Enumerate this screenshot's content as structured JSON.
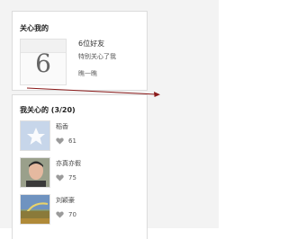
{
  "care_panel": {
    "title": "关心我的",
    "number": "6",
    "count_text": "6位好友",
    "desc_text": "特别关心了我",
    "link_text": "瞧一瞧"
  },
  "following_panel": {
    "title": "我关心的 (3/20)",
    "people": [
      {
        "name": "稻香",
        "count": "61",
        "avatar": "default-avatar"
      },
      {
        "name": "亦真亦假",
        "count": "75",
        "avatar": "face-photo"
      },
      {
        "name": "刘颖豪",
        "count": "70",
        "avatar": "landscape-photo"
      }
    ]
  },
  "colors": {
    "arrow": "#8b1a1a",
    "panel_border": "#dcdcdc"
  }
}
